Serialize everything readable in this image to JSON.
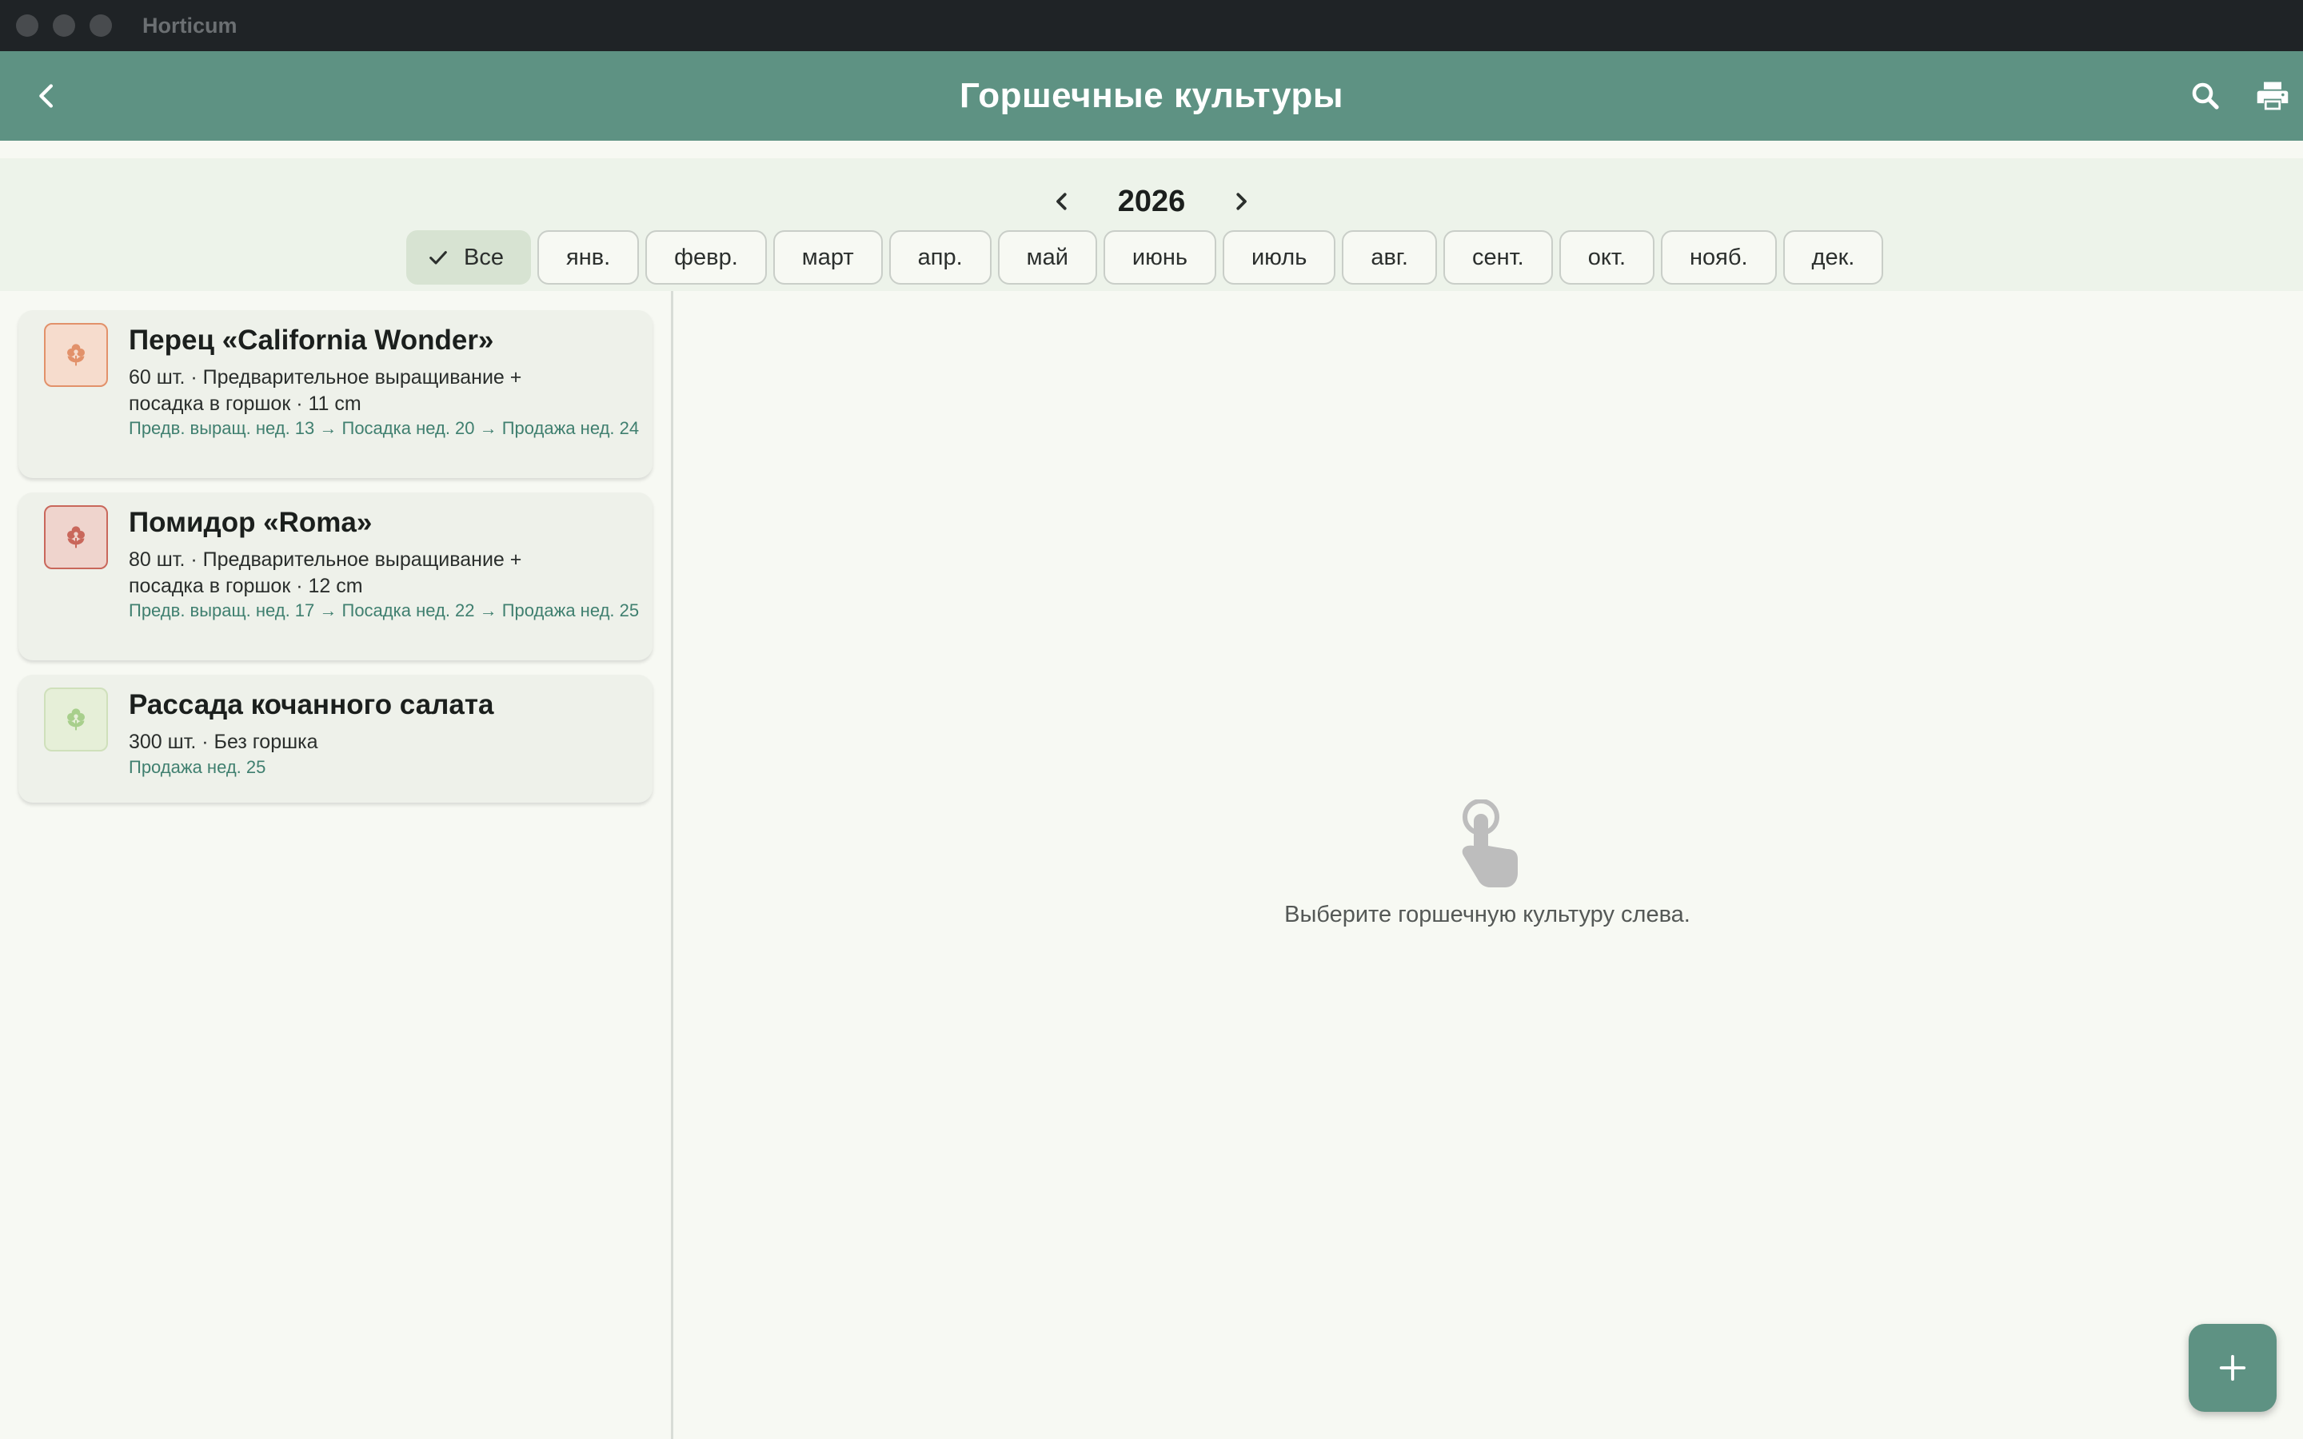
{
  "window": {
    "title": "Horticum"
  },
  "appbar": {
    "title": "Горшечные культуры",
    "back_icon": "arrow-back-icon",
    "search_icon": "search-icon",
    "print_icon": "print-icon",
    "color": "#5e9283"
  },
  "filter": {
    "year": "2026",
    "all_label": "Все",
    "months": [
      "янв.",
      "февр.",
      "март",
      "апр.",
      "май",
      "июнь",
      "июль",
      "авг.",
      "сент.",
      "окт.",
      "нояб.",
      "дек."
    ]
  },
  "crops": [
    {
      "name": "Перец «California Wonder»",
      "desc": "60 шт. · Предварительное выращивание + посадка в горшок · 11 cm",
      "schedule": "Предв. выращ. нед. 13 → Посадка нед. 20 → Продажа нед. 24",
      "icon": "flower-icon",
      "icon_color": "#e2916a",
      "icon_bg": "#f6dccd"
    },
    {
      "name": "Помидор «Roma»",
      "desc": "80 шт. · Предварительное выращивание + посадка в горшок · 12 cm",
      "schedule": "Предв. выращ. нед. 17 → Посадка нед. 22 → Продажа нед. 25",
      "icon": "flower-icon",
      "icon_color": "#c9675b",
      "icon_bg": "#efd4cd"
    },
    {
      "name": "Рассада кочанного салата",
      "desc": "300 шт. · Без горшка",
      "schedule": "Продажа нед. 25",
      "icon": "flower-icon",
      "icon_color": "#a8cf8c",
      "icon_bg": "#e6efd8"
    }
  ],
  "empty_state": {
    "icon": "touch-icon",
    "text": "Выберите горшечную культуру слева."
  },
  "fab": {
    "icon": "plus-icon"
  }
}
